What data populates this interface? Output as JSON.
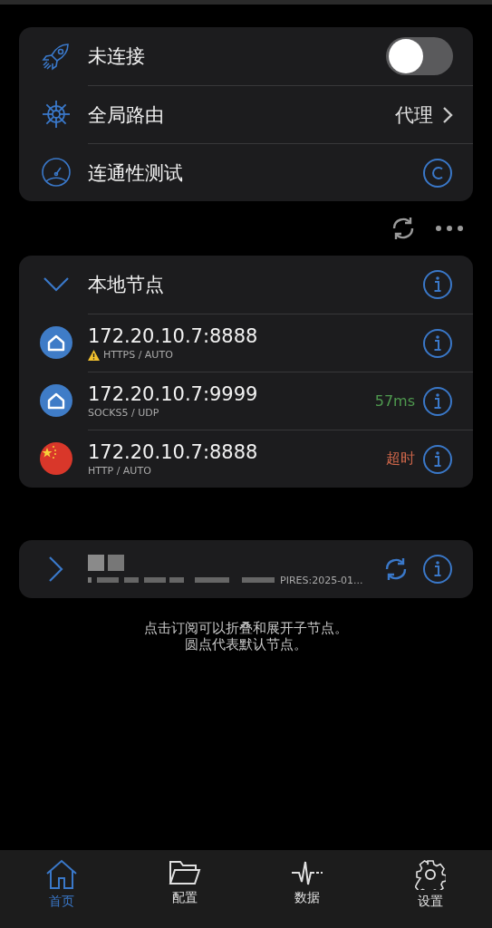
{
  "status_card": {
    "connection": {
      "label": "未连接",
      "on": false
    },
    "routing": {
      "label": "全局路由",
      "value": "代理"
    },
    "test": {
      "label": "连通性测试"
    }
  },
  "local_group": {
    "title": "本地节点",
    "expanded": true,
    "nodes": [
      {
        "address": "172.20.10.7:8888",
        "protocol": "HTTPS / AUTO",
        "kind": "home",
        "warning": true
      },
      {
        "address": "172.20.10.7:9999",
        "protocol": "SOCKS5 / UDP",
        "kind": "home",
        "warning": false,
        "latency": {
          "text": "57ms",
          "kind": "ok"
        }
      },
      {
        "address": "172.20.10.7:8888",
        "protocol": "HTTP / AUTO",
        "kind": "flag",
        "warning": false,
        "latency": {
          "text": "超时",
          "kind": "timeout"
        }
      }
    ]
  },
  "subscription": {
    "expanded": false,
    "detail_tail": "PIRES:2025-01..."
  },
  "hint": [
    "点击订阅可以折叠和展开子节点。",
    "圆点代表默认节点。"
  ],
  "tabs": [
    {
      "label": "首页",
      "kind": "home",
      "selected": true
    },
    {
      "label": "配置",
      "kind": "folder",
      "selected": false
    },
    {
      "label": "数据",
      "kind": "pulse",
      "selected": false
    },
    {
      "label": "设置",
      "kind": "gear",
      "selected": false
    }
  ]
}
